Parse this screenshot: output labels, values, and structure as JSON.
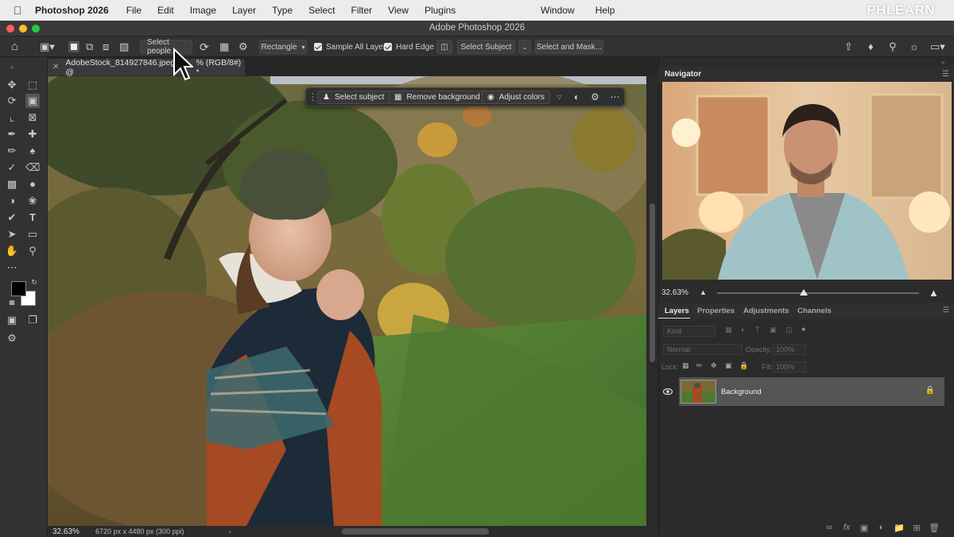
{
  "menubar": {
    "app_name": "Photoshop 2026",
    "items": [
      "File",
      "Edit",
      "Image",
      "Layer",
      "Type",
      "Select",
      "Filter",
      "View",
      "Plugins"
    ],
    "right_items": [
      "Window",
      "Help"
    ],
    "watermark": "PHLEARN"
  },
  "window": {
    "title": "Adobe Photoshop 2026"
  },
  "options_bar": {
    "select_people": "Select people",
    "mode": "Rectangle",
    "sample_all_layers": "Sample All Layers",
    "hard_edge": "Hard Edge",
    "select_subject": "Select Subject",
    "select_and_mask": "Select and Mask..."
  },
  "document": {
    "tab_title": "AdobeStock_814927846.jpeg @",
    "tab_suffix": "% (RGB/8#) *",
    "zoom": "32.63%",
    "info": "6720 px x 4480 px (300 ppi)"
  },
  "contextual_bar": {
    "select_subject": "Select subject",
    "remove_background": "Remove background",
    "adjust_colors": "Adjust colors"
  },
  "navigator": {
    "title": "Navigator",
    "zoom": "32.63%",
    "zoom_fraction": 0.43
  },
  "layers_panel": {
    "tabs": [
      "Layers",
      "Properties",
      "Adjustments",
      "Channels"
    ],
    "kind_placeholder": "Kind",
    "blend_mode": "Normal",
    "opacity_label": "Opacity:",
    "opacity_value": "100%",
    "lock_label": "Lock:",
    "fill_label": "Fill:",
    "fill_value": "100%",
    "layer_name": "Background"
  },
  "colors": {
    "foreground": "#000000",
    "background": "#ffffff"
  }
}
